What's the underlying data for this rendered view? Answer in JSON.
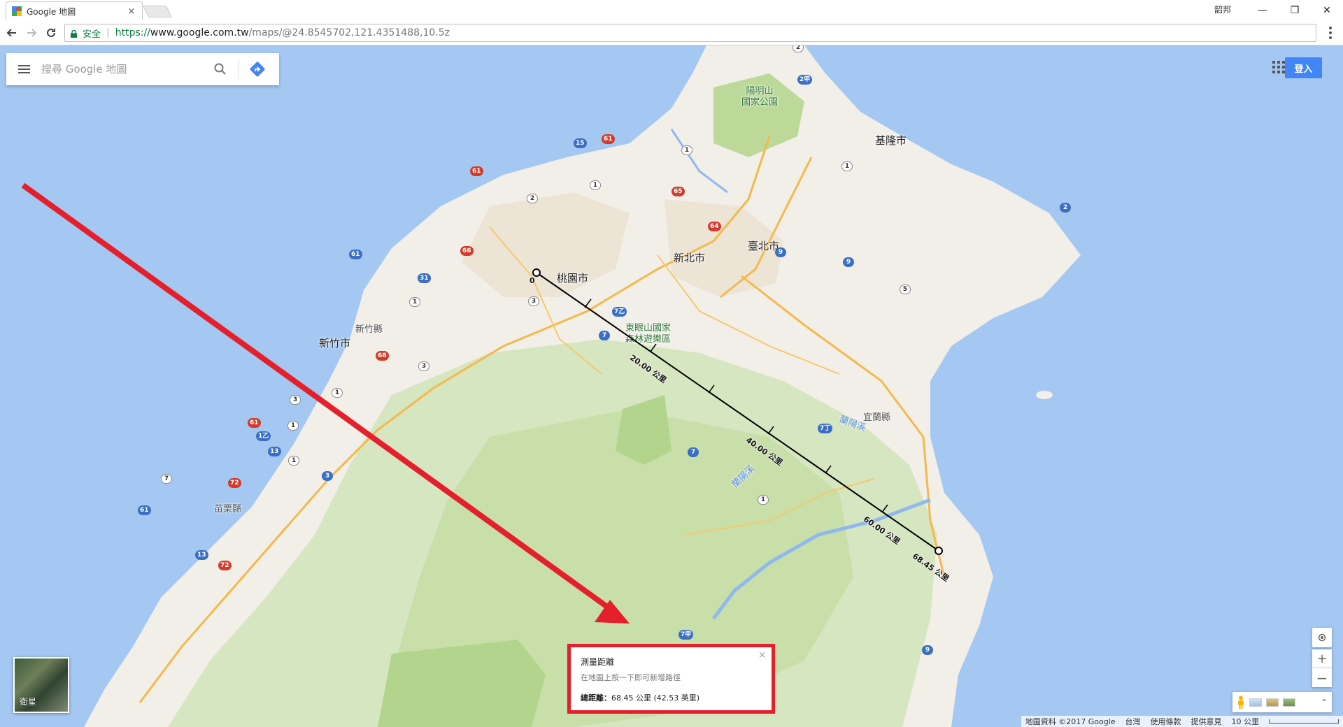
{
  "browser": {
    "tab_title": "Google 地圖",
    "tab_close": "×",
    "user_name": "韶邦",
    "window_minimize": "—",
    "window_restore": "❐",
    "window_close": "✕",
    "secure_label": "安全",
    "url_scheme": "https://",
    "url_host": "www.google.com.tw",
    "url_path": "/maps/@24.8545702,121.4351488,10.5z"
  },
  "search": {
    "placeholder": "搜尋 Google 地圖"
  },
  "header": {
    "signin_label": "登入"
  },
  "map_labels": {
    "cities": [
      "桃園市",
      "新北市",
      "臺北市",
      "基隆市",
      "新竹市"
    ],
    "counties": [
      "新竹縣",
      "苗栗縣",
      "宜蘭縣"
    ],
    "parks": [
      "陽明山\n國家公園",
      "東眼山國家\n森林遊樂區"
    ],
    "rivers": [
      "蘭陽溪",
      "蘭陽溪"
    ],
    "route_shields": [
      "2",
      "2甲",
      "15",
      "61",
      "1",
      "65",
      "2",
      "1",
      "1",
      "9",
      "2",
      "61",
      "66",
      "64",
      "9",
      "31",
      "1",
      "5",
      "7乙",
      "7",
      "3",
      "61",
      "3",
      "68",
      "1",
      "3",
      "1",
      "1",
      "61",
      "1乙",
      "13",
      "3",
      "72",
      "61",
      "13",
      "72",
      "7",
      "7甲",
      "1",
      "7丁",
      "7",
      "9"
    ]
  },
  "measure_line": {
    "start_label": "0",
    "labels": [
      "20.00 公里",
      "40.00 公里",
      "60.00 公里",
      "68.45 公里"
    ]
  },
  "measure_card": {
    "title": "測量距離",
    "hint": "在地圖上按一下即可新增路徑",
    "total_label": "總距離：",
    "total_value": "68.45 公里 (42.53 英里)",
    "close": "×"
  },
  "controls": {
    "satellite_label": "衛星",
    "zoom_in": "+",
    "zoom_out": "−",
    "expand": "⌃"
  },
  "footer": {
    "map_data": "地圖資料 ©2017 Google",
    "region": "台灣",
    "terms": "使用條款",
    "feedback": "提供意見",
    "scale": "10 公里"
  },
  "colors": {
    "water": "#a4c8f2",
    "land": "#f2efe9",
    "forest": "#c8dfaa",
    "highway": "#f5b94b",
    "annotation_red": "#e3202b",
    "accent_blue": "#4285f4"
  }
}
